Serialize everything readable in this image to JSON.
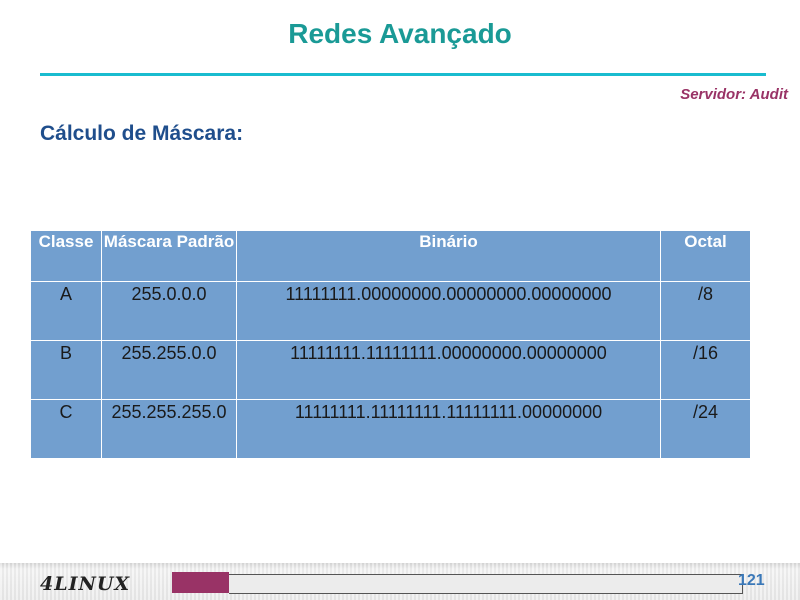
{
  "slide": {
    "title": "Redes Avançado",
    "server": "Servidor: Audit",
    "subtitle": "Cálculo de Máscara:"
  },
  "table": {
    "headers": [
      "Classe",
      "Máscara Padrão",
      "Binário",
      "Octal"
    ],
    "rows": [
      [
        "A",
        "255.0.0.0",
        "11111111.00000000.00000000.00000000",
        "/8"
      ],
      [
        "B",
        "255.255.0.0",
        "11111111.11111111.00000000.00000000",
        "/16"
      ],
      [
        "C",
        "255.255.255.0",
        "11111111.11111111.11111111.00000000",
        "/24"
      ]
    ]
  },
  "footer": {
    "logo": "4LINUX",
    "page_number": "121"
  },
  "colors": {
    "title": "#1a9a96",
    "rule": "#19bccf",
    "server": "#993366",
    "subtitle": "#1f4e8c",
    "table_fill": "#729fcf",
    "accent_bar": "#993366",
    "page_number": "#3a78b8"
  }
}
